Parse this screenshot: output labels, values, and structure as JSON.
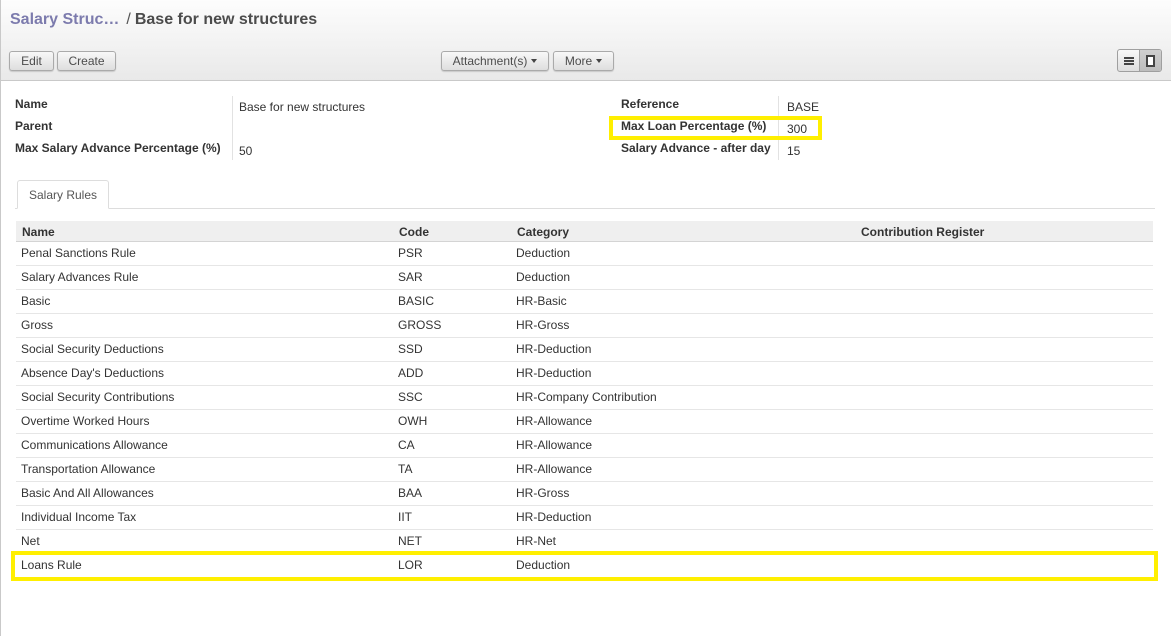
{
  "breadcrumb": {
    "parent": "Salary Struc…",
    "separator": "/",
    "current": "Base for new structures"
  },
  "toolbar": {
    "edit": "Edit",
    "create": "Create",
    "attachments": "Attachment(s)",
    "more": "More"
  },
  "form": {
    "name_label": "Name",
    "name_value": "Base for new structures",
    "parent_label": "Parent",
    "parent_value": "",
    "max_advance_label": "Max Salary Advance Percentage (%)",
    "max_advance_value": "50",
    "reference_label": "Reference",
    "reference_value": "BASE",
    "max_loan_label": "Max Loan Percentage (%)",
    "max_loan_value": "300",
    "advance_after_label": "Salary Advance - after day",
    "advance_after_value": "15"
  },
  "tabs": {
    "salary_rules": "Salary Rules"
  },
  "table": {
    "headers": {
      "name": "Name",
      "code": "Code",
      "category": "Category",
      "register": "Contribution Register"
    },
    "rows": [
      {
        "name": "Penal Sanctions Rule",
        "code": "PSR",
        "category": "Deduction",
        "register": ""
      },
      {
        "name": "Salary Advances Rule",
        "code": "SAR",
        "category": "Deduction",
        "register": ""
      },
      {
        "name": "Basic",
        "code": "BASIC",
        "category": "HR-Basic",
        "register": ""
      },
      {
        "name": "Gross",
        "code": "GROSS",
        "category": "HR-Gross",
        "register": ""
      },
      {
        "name": "Social Security Deductions",
        "code": "SSD",
        "category": "HR-Deduction",
        "register": ""
      },
      {
        "name": "Absence Day's Deductions",
        "code": "ADD",
        "category": "HR-Deduction",
        "register": ""
      },
      {
        "name": "Social Security Contributions",
        "code": "SSC",
        "category": "HR-Company Contribution",
        "register": ""
      },
      {
        "name": "Overtime Worked Hours",
        "code": "OWH",
        "category": "HR-Allowance",
        "register": ""
      },
      {
        "name": "Communications Allowance",
        "code": "CA",
        "category": "HR-Allowance",
        "register": ""
      },
      {
        "name": "Transportation Allowance",
        "code": "TA",
        "category": "HR-Allowance",
        "register": ""
      },
      {
        "name": "Basic And All Allowances",
        "code": "BAA",
        "category": "HR-Gross",
        "register": ""
      },
      {
        "name": "Individual Income Tax",
        "code": "IIT",
        "category": "HR-Deduction",
        "register": ""
      },
      {
        "name": "Net",
        "code": "NET",
        "category": "HR-Net",
        "register": ""
      },
      {
        "name": "Loans Rule",
        "code": "LOR",
        "category": "Deduction",
        "register": ""
      }
    ]
  },
  "colors": {
    "breadcrumb_link": "#7c7bad",
    "highlight": "#ffef00",
    "header_bg": "#efefef"
  },
  "icons": {
    "list_view": "list-view-icon",
    "form_view": "form-view-icon",
    "dropdown": "caret-down-icon"
  }
}
